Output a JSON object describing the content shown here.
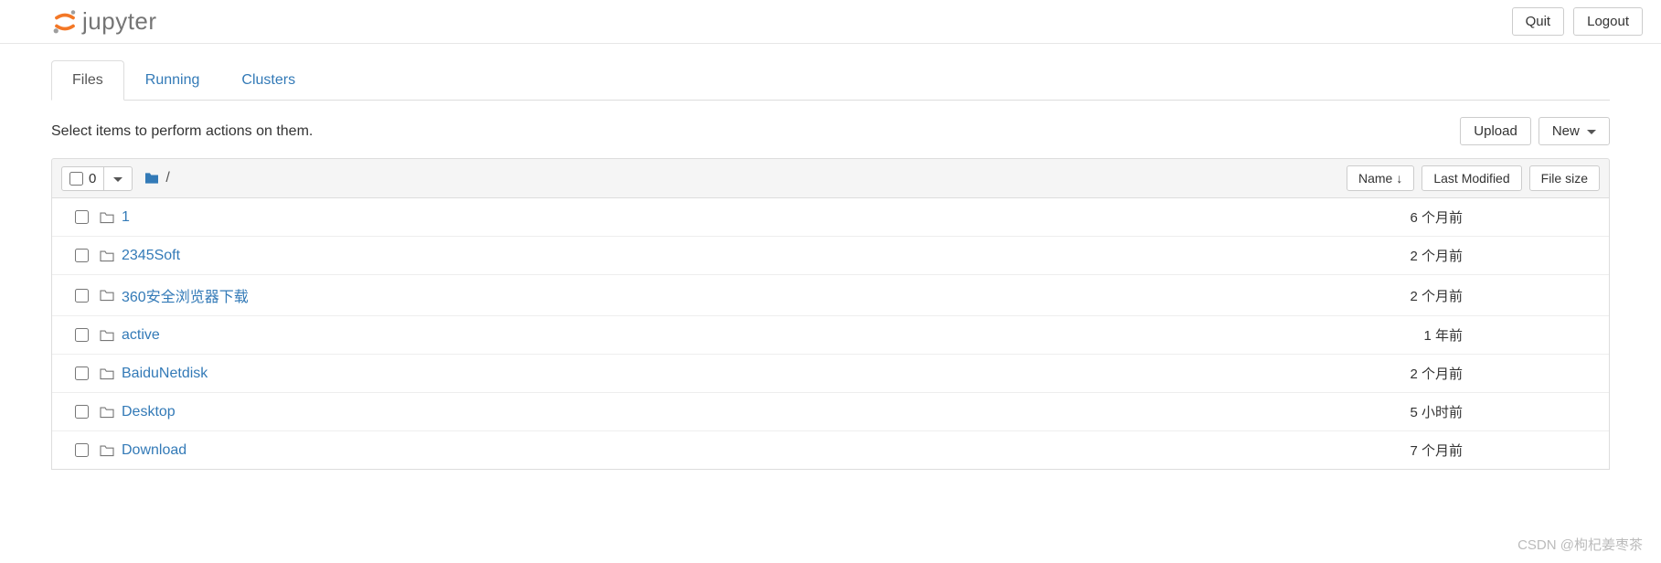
{
  "header": {
    "logo_text": "jupyter",
    "quit_label": "Quit",
    "logout_label": "Logout"
  },
  "tabs": {
    "files": "Files",
    "running": "Running",
    "clusters": "Clusters"
  },
  "toolbar": {
    "hint": "Select items to perform actions on them.",
    "upload_label": "Upload",
    "new_label": "New"
  },
  "list_header": {
    "selected_count": "0",
    "breadcrumb_root": "/",
    "name_label": "Name",
    "modified_label": "Last Modified",
    "size_label": "File size"
  },
  "files": [
    {
      "name": "1",
      "modified": "6 个月前",
      "size": ""
    },
    {
      "name": "2345Soft",
      "modified": "2 个月前",
      "size": ""
    },
    {
      "name": "360安全浏览器下载",
      "modified": "2 个月前",
      "size": ""
    },
    {
      "name": "active",
      "modified": "1 年前",
      "size": ""
    },
    {
      "name": "BaiduNetdisk",
      "modified": "2 个月前",
      "size": ""
    },
    {
      "name": "Desktop",
      "modified": "5 小时前",
      "size": ""
    },
    {
      "name": "Download",
      "modified": "7 个月前",
      "size": ""
    }
  ],
  "watermark": "CSDN @枸杞姜枣茶"
}
